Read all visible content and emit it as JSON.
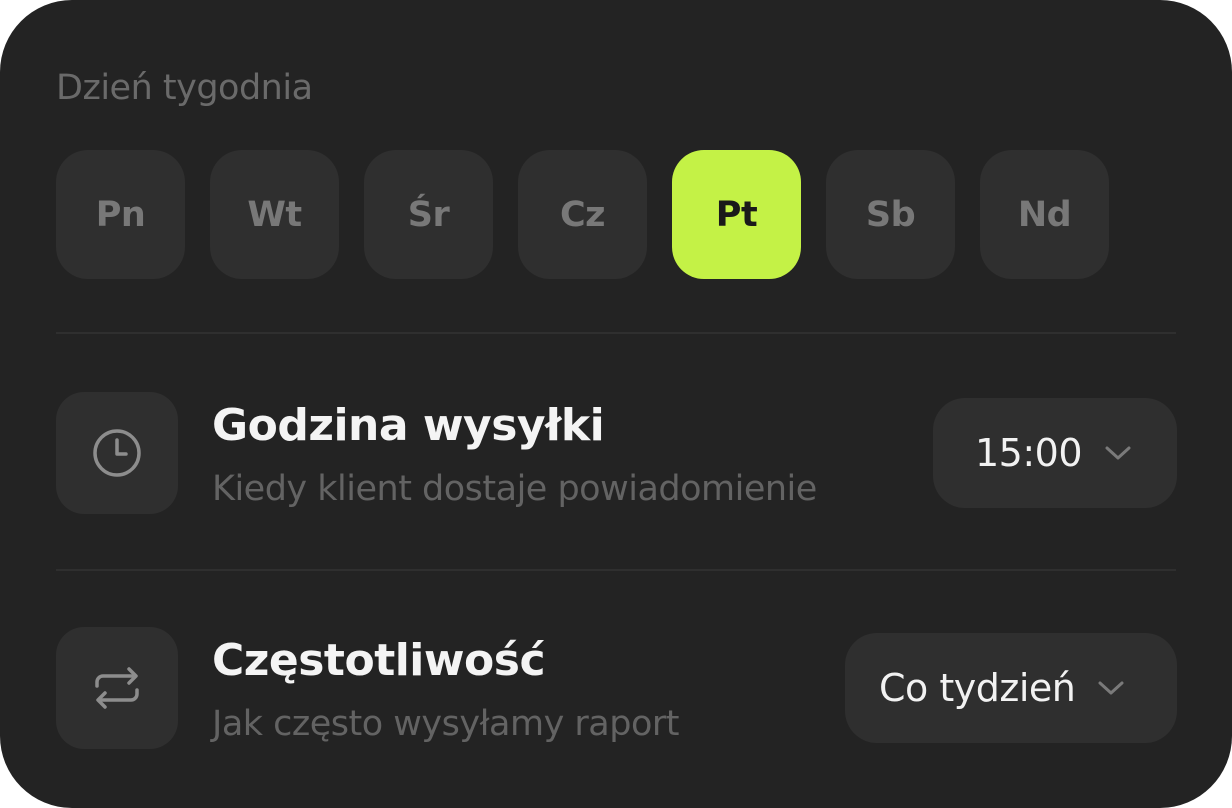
{
  "week_day": {
    "label": "Dzień tygodnia",
    "days": [
      "Pn",
      "Wt",
      "Śr",
      "Cz",
      "Pt",
      "Sb",
      "Nd"
    ],
    "selected": "Pt",
    "accent_color": "#c4f246"
  },
  "send_time": {
    "icon": "clock-icon",
    "title": "Godzina wysyłki",
    "subtitle": "Kiedy klient dostaje powiadomienie",
    "value": "15:00"
  },
  "frequency": {
    "icon": "repeat-icon",
    "title": "Częstotliwość",
    "subtitle": "Jak często wysyłamy raport",
    "value": "Co tydzień"
  }
}
